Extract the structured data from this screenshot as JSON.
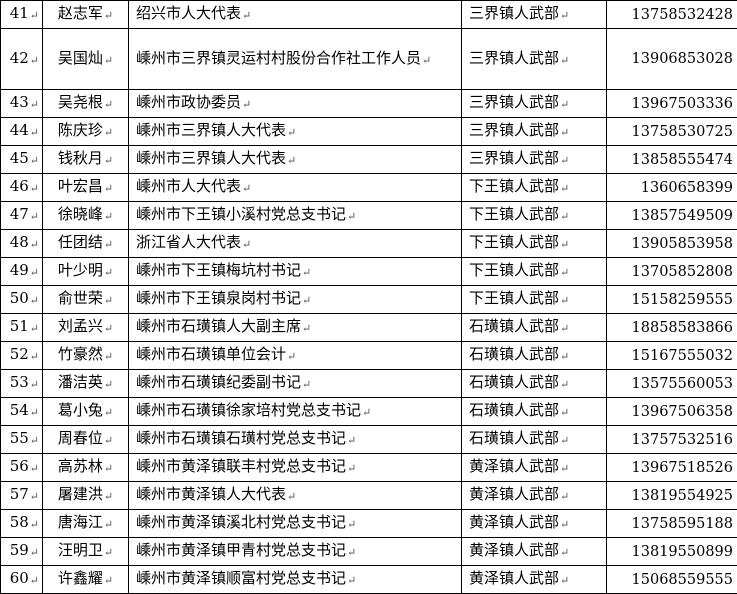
{
  "table": {
    "rows": [
      {
        "no": "41",
        "name": "赵志军",
        "unit": "绍兴市人大代表",
        "dept": "三界镇人武部",
        "phone": "13758532428"
      },
      {
        "no": "42",
        "name": "吴国灿",
        "unit": "嵊州市三界镇灵运村村股份合作社工作人员",
        "dept": "三界镇人武部",
        "phone": "13906853028"
      },
      {
        "no": "43",
        "name": "吴尧根",
        "unit": "嵊州市政协委员",
        "dept": "三界镇人武部",
        "phone": "13967503336"
      },
      {
        "no": "44",
        "name": "陈庆珍",
        "unit": "嵊州市三界镇人大代表",
        "dept": "三界镇人武部",
        "phone": "13758530725"
      },
      {
        "no": "45",
        "name": "钱秋月",
        "unit": "嵊州市三界镇人大代表",
        "dept": "三界镇人武部",
        "phone": "13858555474"
      },
      {
        "no": "46",
        "name": "叶宏昌",
        "unit": "嵊州市人大代表",
        "dept": "下王镇人武部",
        "phone": "1360658399"
      },
      {
        "no": "47",
        "name": "徐晓峰",
        "unit": "嵊州市下王镇小溪村党总支书记",
        "dept": "下王镇人武部",
        "phone": "13857549509"
      },
      {
        "no": "48",
        "name": "任团结",
        "unit": "浙江省人大代表",
        "dept": "下王镇人武部",
        "phone": "13905853958"
      },
      {
        "no": "49",
        "name": "叶少明",
        "unit": "嵊州市下王镇梅坑村书记",
        "dept": "下王镇人武部",
        "phone": "13705852808"
      },
      {
        "no": "50",
        "name": "俞世荣",
        "unit": "嵊州市下王镇泉岗村书记",
        "dept": "下王镇人武部",
        "phone": "15158259555"
      },
      {
        "no": "51",
        "name": "刘孟兴",
        "unit": "嵊州市石璜镇人大副主席",
        "dept": "石璜镇人武部",
        "phone": "18858583866"
      },
      {
        "no": "52",
        "name": "竹豪然",
        "unit": "嵊州市石璜镇单位会计",
        "dept": "石璜镇人武部",
        "phone": "15167555032"
      },
      {
        "no": "53",
        "name": "潘洁英",
        "unit": "嵊州市石璜镇纪委副书记",
        "dept": "石璜镇人武部",
        "phone": "13575560053"
      },
      {
        "no": "54",
        "name": "葛小兔",
        "unit": "嵊州市石璜镇徐家培村党总支书记",
        "dept": "石璜镇人武部",
        "phone": "13967506358"
      },
      {
        "no": "55",
        "name": "周春位",
        "unit": "嵊州市石璜镇石璜村党总支书记",
        "dept": "石璜镇人武部",
        "phone": "13757532516"
      },
      {
        "no": "56",
        "name": "高苏林",
        "unit": "嵊州市黄泽镇联丰村党总支书记",
        "dept": "黄泽镇人武部",
        "phone": "13967518526"
      },
      {
        "no": "57",
        "name": "屠建洪",
        "unit": "嵊州市黄泽镇人大代表",
        "dept": "黄泽镇人武部",
        "phone": "13819554925"
      },
      {
        "no": "58",
        "name": "唐海江",
        "unit": "嵊州市黄泽镇溪北村党总支书记",
        "dept": "黄泽镇人武部",
        "phone": "13758595188"
      },
      {
        "no": "59",
        "name": "汪明卫",
        "unit": "嵊州市黄泽镇甲青村党总支书记",
        "dept": "黄泽镇人武部",
        "phone": "13819550899"
      },
      {
        "no": "60",
        "name": "许鑫耀",
        "unit": "嵊州市黄泽镇顺富村党总支书记",
        "dept": "黄泽镇人武部",
        "phone": "15068559555"
      }
    ]
  }
}
